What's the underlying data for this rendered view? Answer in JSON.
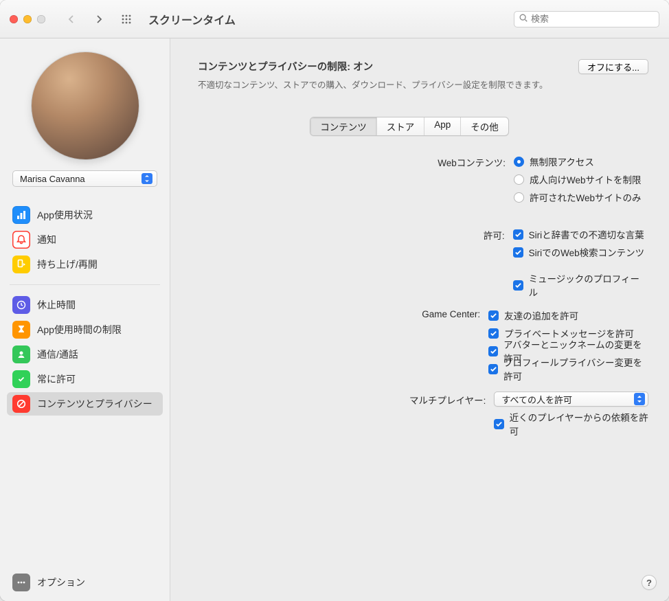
{
  "window": {
    "title": "スクリーンタイム"
  },
  "search": {
    "placeholder": "検索"
  },
  "user": {
    "name": "Marisa Cavanna"
  },
  "sidebar": {
    "items": [
      {
        "label": "App使用状況"
      },
      {
        "label": "通知"
      },
      {
        "label": "持ち上げ/再開"
      },
      {
        "label": "休止時間"
      },
      {
        "label": "App使用時間の制限"
      },
      {
        "label": "通信/通話"
      },
      {
        "label": "常に許可"
      },
      {
        "label": "コンテンツとプライバシー"
      }
    ],
    "options_label": "オプション"
  },
  "header": {
    "title_prefix": "コンテンツとプライバシーの制限: ",
    "status": "オン",
    "subtitle": "不適切なコンテンツ、ストアでの購入、ダウンロード、プライバシー設定を制限できます。",
    "turn_off_label": "オフにする..."
  },
  "tabs": [
    {
      "label": "コンテンツ",
      "active": true
    },
    {
      "label": "ストア",
      "active": false
    },
    {
      "label": "App",
      "active": false
    },
    {
      "label": "その他",
      "active": false
    }
  ],
  "form": {
    "web_content": {
      "label": "Webコンテンツ:",
      "options": [
        {
          "label": "無制限アクセス",
          "checked": true
        },
        {
          "label": "成人向けWebサイトを制限",
          "checked": false
        },
        {
          "label": "許可されたWebサイトのみ",
          "checked": false
        }
      ]
    },
    "allow": {
      "label": "許可:",
      "options": [
        {
          "label": "Siriと辞書での不適切な言葉",
          "checked": true
        },
        {
          "label": "SiriでのWeb検索コンテンツ",
          "checked": true
        },
        {
          "label": "ミュージックのプロフィール",
          "checked": true,
          "spaced": true
        }
      ]
    },
    "game_center": {
      "label": "Game Center:",
      "options": [
        {
          "label": "友達の追加を許可",
          "checked": true
        },
        {
          "label": "プライベートメッセージを許可",
          "checked": true
        },
        {
          "label": "アバターとニックネームの変更を許可",
          "checked": true
        },
        {
          "label": "プロフィールプライバシー変更を許可",
          "checked": true
        }
      ]
    },
    "multiplayer": {
      "label": "マルチプレイヤー:",
      "selected": "すべての人を許可",
      "nearby": {
        "label": "近くのプレイヤーからの依頼を許可",
        "checked": true
      }
    }
  },
  "help_glyph": "?"
}
